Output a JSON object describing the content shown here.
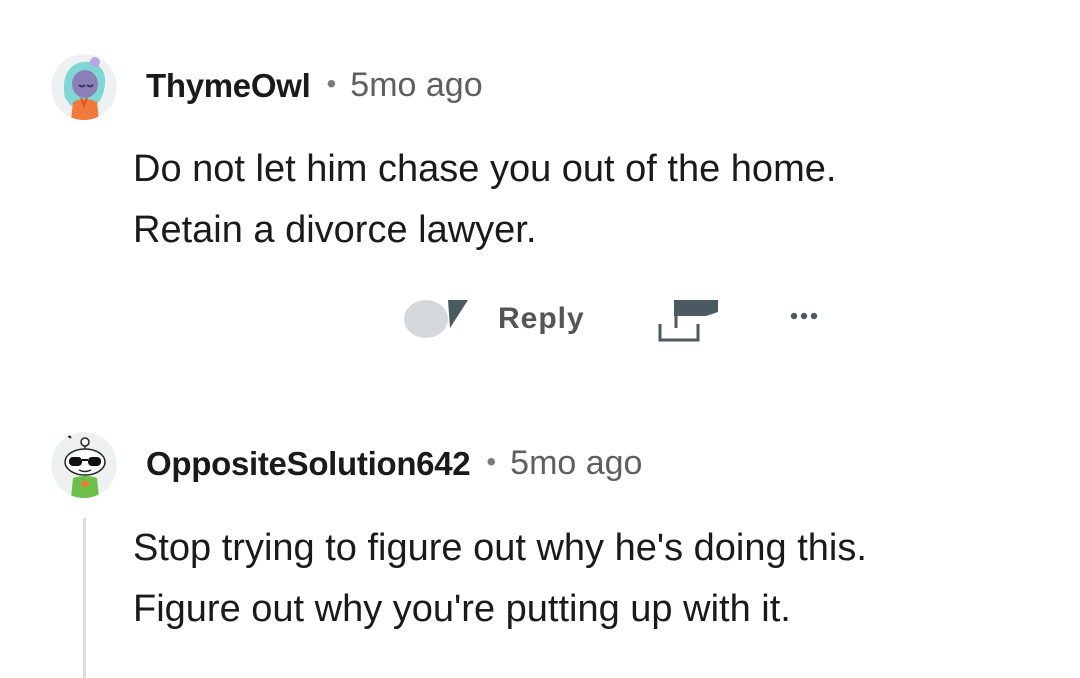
{
  "comments": [
    {
      "username": "ThymeOwl",
      "separator": "•",
      "timestamp": "5mo ago",
      "lines": [
        "Do not let him chase you out of the home.",
        "Retain a divorce lawyer."
      ],
      "actions": {
        "reply_label": "Reply",
        "more_label": "•••"
      }
    },
    {
      "username": "OppositeSolution642",
      "separator": "•",
      "timestamp": "5mo ago",
      "lines": [
        "Stop trying to figure out why he's doing this.",
        "Figure out why you're putting up with it."
      ]
    }
  ],
  "colors": {
    "text": "#1a1a1b",
    "meta": "#5f5f5f",
    "icon": "#4a5a60",
    "thread_line": "#dcdcdc"
  },
  "icons": {
    "avatar_1": "avatar-teal-hair-icon",
    "avatar_2": "avatar-snoo-sunglasses-icon",
    "reply": "reply-bubble-icon",
    "share": "share-icon",
    "more": "more-dots-icon"
  }
}
